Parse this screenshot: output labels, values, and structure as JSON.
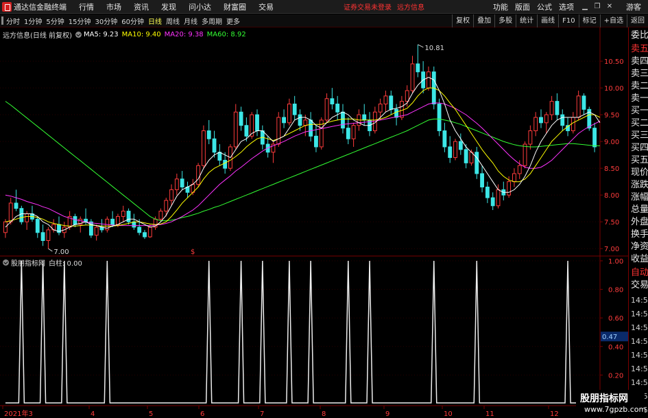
{
  "menubar": {
    "title": "通达信金融终端",
    "items": [
      "行情",
      "市场",
      "资讯",
      "发现",
      "问小达",
      "财富圈",
      "交易"
    ],
    "status_login": "证券交易未登录",
    "status_stock": "远方信息",
    "right_items": [
      "功能",
      "版面",
      "公式",
      "选项"
    ],
    "guest": "游客"
  },
  "toolbar": {
    "periods": [
      "分时",
      "1分钟",
      "5分钟",
      "15分钟",
      "30分钟",
      "60分钟",
      "日线",
      "周线",
      "月线",
      "多周期",
      "更多"
    ],
    "active_period": "日线",
    "right_buttons": [
      "复权",
      "叠加",
      "多股",
      "统计",
      "画线",
      "F10",
      "标记",
      "+自选",
      "返回"
    ]
  },
  "legend": {
    "title": "远方信息(日线 前复权)",
    "ma5": "MA5: 9.23",
    "ma10": "MA10: 9.40",
    "ma20": "MA20: 9.38",
    "ma60": "MA60: 8.92"
  },
  "sub_legend": {
    "title": "股朋指标网",
    "value": "白柱: 0.00"
  },
  "side_panel": {
    "labels": [
      "委比",
      "卖五",
      "卖四",
      "卖三",
      "卖二",
      "卖一",
      "买一",
      "买二",
      "买三",
      "买四",
      "买五",
      "现价",
      "涨跌",
      "涨幅",
      "总量",
      "外盘",
      "换手",
      "净资",
      "收益"
    ],
    "auto_trade": [
      "自动",
      "交易"
    ],
    "times": [
      "14:5",
      "14:5",
      "14:5",
      "14:5",
      "14:5",
      "14:5",
      "14:5",
      "14:5",
      "14:5"
    ]
  },
  "watermark": {
    "name": "股朋指标网",
    "url": "www.7gpzb.com"
  },
  "colors": {
    "up": "#ff3c3c",
    "down": "#3ce6e6",
    "ma5": "#ffffff",
    "ma10": "#ffff00",
    "ma20": "#ff33ff",
    "ma60": "#33ff33",
    "grid": "#7a0000"
  },
  "chart_data": [
    {
      "type": "candlestick",
      "y_axis_labels": [
        "10.50",
        "10.00",
        "9.50",
        "9.00",
        "8.50",
        "8.00",
        "7.50",
        "7.00"
      ],
      "ylim": [
        6.9,
        10.95
      ],
      "annotations": {
        "max": "10.81",
        "min": "7.00"
      },
      "x_axis_labels": [
        "2021年3",
        "4",
        "5",
        "6",
        "7",
        "8",
        "9",
        "10",
        "11",
        "12"
      ],
      "ohlc": [
        [
          7.3,
          7.55,
          7.2,
          7.5
        ],
        [
          7.5,
          7.95,
          7.45,
          7.85
        ],
        [
          7.85,
          8.1,
          7.7,
          7.75
        ],
        [
          7.75,
          7.8,
          7.45,
          7.5
        ],
        [
          7.5,
          7.7,
          7.35,
          7.65
        ],
        [
          7.65,
          7.8,
          7.5,
          7.55
        ],
        [
          7.55,
          7.6,
          7.2,
          7.3
        ],
        [
          7.3,
          7.45,
          7.05,
          7.15
        ],
        [
          7.15,
          7.4,
          7.0,
          7.35
        ],
        [
          7.35,
          7.55,
          7.3,
          7.45
        ],
        [
          7.45,
          7.6,
          7.25,
          7.3
        ],
        [
          7.3,
          7.5,
          7.2,
          7.4
        ],
        [
          7.4,
          7.7,
          7.35,
          7.6
        ],
        [
          7.6,
          7.65,
          7.4,
          7.45
        ],
        [
          7.45,
          7.6,
          7.3,
          7.55
        ],
        [
          7.55,
          7.75,
          7.45,
          7.5
        ],
        [
          7.5,
          7.55,
          7.2,
          7.25
        ],
        [
          7.25,
          7.45,
          7.15,
          7.4
        ],
        [
          7.4,
          7.55,
          7.3,
          7.35
        ],
        [
          7.35,
          7.6,
          7.3,
          7.55
        ],
        [
          7.55,
          7.7,
          7.4,
          7.45
        ],
        [
          7.45,
          7.65,
          7.4,
          7.6
        ],
        [
          7.6,
          7.8,
          7.5,
          7.7
        ],
        [
          7.7,
          7.75,
          7.45,
          7.5
        ],
        [
          7.5,
          7.65,
          7.35,
          7.4
        ],
        [
          7.4,
          7.55,
          7.25,
          7.3
        ],
        [
          7.3,
          7.35,
          7.18,
          7.22
        ],
        [
          7.22,
          7.45,
          7.2,
          7.4
        ],
        [
          7.4,
          7.6,
          7.35,
          7.55
        ],
        [
          7.55,
          7.75,
          7.5,
          7.7
        ],
        [
          7.7,
          7.95,
          7.6,
          7.9
        ],
        [
          7.9,
          8.2,
          7.8,
          8.1
        ],
        [
          8.1,
          8.4,
          8.0,
          8.3
        ],
        [
          8.3,
          8.45,
          8.1,
          8.15
        ],
        [
          8.15,
          8.25,
          7.95,
          8.05
        ],
        [
          8.05,
          8.3,
          8.0,
          8.2
        ],
        [
          8.2,
          8.6,
          8.15,
          8.55
        ],
        [
          8.55,
          9.3,
          8.5,
          9.2
        ],
        [
          9.2,
          9.4,
          8.95,
          9.05
        ],
        [
          9.05,
          9.2,
          8.7,
          8.8
        ],
        [
          8.8,
          8.95,
          8.55,
          8.65
        ],
        [
          8.65,
          8.8,
          8.4,
          8.5
        ],
        [
          8.5,
          8.95,
          8.45,
          8.9
        ],
        [
          8.9,
          9.7,
          8.85,
          9.55
        ],
        [
          9.55,
          9.65,
          9.2,
          9.3
        ],
        [
          9.3,
          9.45,
          9.0,
          9.1
        ],
        [
          9.1,
          9.55,
          9.05,
          9.5
        ],
        [
          9.5,
          9.6,
          9.1,
          9.2
        ],
        [
          9.2,
          9.3,
          8.85,
          8.95
        ],
        [
          8.95,
          9.1,
          8.7,
          8.8
        ],
        [
          8.8,
          9.0,
          8.6,
          8.95
        ],
        [
          8.95,
          9.55,
          8.9,
          9.45
        ],
        [
          9.45,
          9.6,
          9.25,
          9.35
        ],
        [
          9.35,
          9.8,
          9.3,
          9.7
        ],
        [
          9.7,
          9.85,
          9.4,
          9.5
        ],
        [
          9.5,
          9.6,
          9.2,
          9.3
        ],
        [
          9.3,
          9.5,
          9.1,
          9.4
        ],
        [
          9.4,
          9.55,
          9.0,
          9.1
        ],
        [
          9.1,
          9.3,
          8.8,
          8.9
        ],
        [
          8.9,
          9.45,
          8.85,
          9.4
        ],
        [
          9.4,
          9.9,
          9.35,
          9.8
        ],
        [
          9.8,
          10.0,
          9.6,
          9.7
        ],
        [
          9.7,
          9.85,
          9.4,
          9.55
        ],
        [
          9.55,
          9.7,
          9.15,
          9.25
        ],
        [
          9.25,
          9.45,
          8.95,
          9.05
        ],
        [
          9.05,
          9.35,
          8.9,
          9.3
        ],
        [
          9.3,
          9.6,
          9.2,
          9.5
        ],
        [
          9.5,
          9.7,
          9.3,
          9.4
        ],
        [
          9.4,
          9.55,
          9.1,
          9.2
        ],
        [
          9.2,
          9.65,
          9.15,
          9.55
        ],
        [
          9.55,
          9.8,
          9.4,
          9.7
        ],
        [
          9.7,
          9.95,
          9.55,
          9.85
        ],
        [
          9.85,
          9.95,
          9.5,
          9.6
        ],
        [
          9.6,
          9.7,
          9.3,
          9.45
        ],
        [
          9.45,
          9.85,
          9.4,
          9.75
        ],
        [
          9.75,
          10.05,
          9.65,
          9.95
        ],
        [
          9.95,
          10.6,
          9.9,
          10.45
        ],
        [
          10.45,
          10.81,
          10.2,
          10.3
        ],
        [
          10.3,
          10.5,
          9.9,
          10.0
        ],
        [
          10.0,
          10.4,
          9.95,
          10.3
        ],
        [
          10.3,
          10.4,
          9.6,
          9.7
        ],
        [
          9.7,
          9.8,
          9.1,
          9.2
        ],
        [
          9.2,
          9.35,
          8.8,
          8.9
        ],
        [
          8.9,
          9.1,
          8.6,
          8.7
        ],
        [
          8.7,
          9.05,
          8.65,
          9.0
        ],
        [
          9.0,
          9.15,
          8.75,
          8.85
        ],
        [
          8.85,
          8.95,
          8.5,
          8.6
        ],
        [
          8.6,
          8.85,
          8.55,
          8.8
        ],
        [
          8.8,
          8.9,
          8.3,
          8.4
        ],
        [
          8.4,
          8.55,
          8.05,
          8.15
        ],
        [
          8.15,
          8.25,
          7.85,
          7.95
        ],
        [
          7.95,
          8.05,
          7.72,
          7.8
        ],
        [
          7.8,
          8.2,
          7.75,
          8.1
        ],
        [
          8.1,
          8.25,
          7.9,
          8.0
        ],
        [
          8.0,
          8.35,
          7.95,
          8.25
        ],
        [
          8.25,
          8.5,
          8.15,
          8.4
        ],
        [
          8.4,
          8.65,
          8.3,
          8.55
        ],
        [
          8.55,
          9.0,
          8.5,
          8.95
        ],
        [
          8.95,
          9.3,
          8.85,
          9.2
        ],
        [
          9.2,
          9.55,
          9.1,
          9.45
        ],
        [
          9.45,
          9.6,
          9.25,
          9.35
        ],
        [
          9.35,
          9.55,
          9.15,
          9.5
        ],
        [
          9.5,
          9.85,
          9.4,
          9.75
        ],
        [
          9.75,
          9.9,
          9.4,
          9.5
        ],
        [
          9.5,
          9.6,
          9.2,
          9.3
        ],
        [
          9.3,
          9.45,
          9.1,
          9.2
        ],
        [
          9.2,
          9.55,
          9.15,
          9.45
        ],
        [
          9.45,
          9.95,
          9.4,
          9.85
        ],
        [
          9.85,
          9.9,
          9.5,
          9.6
        ],
        [
          9.6,
          9.65,
          9.2,
          9.25
        ],
        [
          9.25,
          9.35,
          8.8,
          8.9
        ]
      ],
      "ma5": [
        7.4,
        7.5,
        7.6,
        7.65,
        7.65,
        7.65,
        7.6,
        7.5,
        7.45,
        7.35,
        7.32,
        7.35,
        7.4,
        7.45,
        7.47,
        7.5,
        7.45,
        7.43,
        7.4,
        7.38,
        7.42,
        7.45,
        7.5,
        7.55,
        7.55,
        7.5,
        7.45,
        7.4,
        7.42,
        7.5,
        7.62,
        7.8,
        7.98,
        8.1,
        8.15,
        8.2,
        8.3,
        8.5,
        8.65,
        8.75,
        8.8,
        8.75,
        8.7,
        8.85,
        9.0,
        9.05,
        9.15,
        9.2,
        9.2,
        9.1,
        9.0,
        9.05,
        9.1,
        9.25,
        9.4,
        9.45,
        9.45,
        9.4,
        9.3,
        9.25,
        9.35,
        9.45,
        9.5,
        9.55,
        9.5,
        9.4,
        9.35,
        9.3,
        9.3,
        9.35,
        9.45,
        9.55,
        9.6,
        9.62,
        9.65,
        9.72,
        9.9,
        10.05,
        10.15,
        10.2,
        10.15,
        9.95,
        9.7,
        9.4,
        9.2,
        9.05,
        8.9,
        8.8,
        8.7,
        8.55,
        8.4,
        8.25,
        8.1,
        8.05,
        8.05,
        8.1,
        8.2,
        8.35,
        8.55,
        8.8,
        9.0,
        9.15,
        9.3,
        9.4,
        9.45,
        9.45,
        9.45,
        9.45,
        9.5,
        9.55,
        9.5,
        9.35
      ],
      "ma10": [
        7.5,
        7.52,
        7.55,
        7.58,
        7.6,
        7.6,
        7.58,
        7.55,
        7.5,
        7.47,
        7.45,
        7.43,
        7.42,
        7.42,
        7.43,
        7.44,
        7.44,
        7.43,
        7.42,
        7.42,
        7.42,
        7.43,
        7.45,
        7.47,
        7.5,
        7.5,
        7.48,
        7.46,
        7.45,
        7.46,
        7.5,
        7.6,
        7.72,
        7.85,
        7.95,
        8.05,
        8.15,
        8.3,
        8.42,
        8.5,
        8.55,
        8.6,
        8.65,
        8.72,
        8.8,
        8.9,
        8.98,
        9.05,
        9.08,
        9.05,
        9.02,
        9.05,
        9.1,
        9.15,
        9.2,
        9.25,
        9.3,
        9.32,
        9.32,
        9.32,
        9.35,
        9.38,
        9.4,
        9.42,
        9.42,
        9.42,
        9.4,
        9.4,
        9.4,
        9.4,
        9.42,
        9.45,
        9.5,
        9.55,
        9.58,
        9.62,
        9.72,
        9.85,
        9.95,
        10.0,
        10.0,
        9.95,
        9.85,
        9.72,
        9.6,
        9.45,
        9.3,
        9.15,
        9.0,
        8.85,
        8.72,
        8.6,
        8.45,
        8.35,
        8.28,
        8.25,
        8.25,
        8.3,
        8.4,
        8.55,
        8.7,
        8.85,
        9.0,
        9.1,
        9.2,
        9.28,
        9.35,
        9.4,
        9.45,
        9.5,
        9.5,
        9.45
      ],
      "ma20": [
        8.0,
        7.98,
        7.95,
        7.92,
        7.88,
        7.85,
        7.82,
        7.78,
        7.75,
        7.7,
        7.65,
        7.6,
        7.57,
        7.54,
        7.52,
        7.5,
        7.48,
        7.47,
        7.46,
        7.45,
        7.44,
        7.43,
        7.43,
        7.43,
        7.43,
        7.43,
        7.43,
        7.43,
        7.44,
        7.45,
        7.47,
        7.5,
        7.55,
        7.6,
        7.66,
        7.72,
        7.8,
        7.9,
        8.0,
        8.1,
        8.2,
        8.28,
        8.36,
        8.45,
        8.52,
        8.6,
        8.68,
        8.75,
        8.82,
        8.88,
        8.92,
        8.96,
        9.0,
        9.05,
        9.1,
        9.14,
        9.18,
        9.2,
        9.22,
        9.24,
        9.26,
        9.28,
        9.3,
        9.32,
        9.33,
        9.34,
        9.35,
        9.36,
        9.37,
        9.38,
        9.4,
        9.42,
        9.44,
        9.46,
        9.48,
        9.5,
        9.55,
        9.6,
        9.65,
        9.7,
        9.72,
        9.72,
        9.7,
        9.66,
        9.62,
        9.56,
        9.5,
        9.42,
        9.34,
        9.25,
        9.15,
        9.05,
        8.95,
        8.85,
        8.75,
        8.66,
        8.58,
        8.52,
        8.5,
        8.5,
        8.52,
        8.58,
        8.65,
        8.75,
        8.85,
        8.95,
        9.05,
        9.15,
        9.22,
        9.28,
        9.33,
        9.38
      ],
      "ma60": [
        9.75,
        9.68,
        9.6,
        9.52,
        9.44,
        9.36,
        9.28,
        9.2,
        9.12,
        9.04,
        8.96,
        8.88,
        8.8,
        8.72,
        8.64,
        8.56,
        8.48,
        8.4,
        8.32,
        8.24,
        8.16,
        8.08,
        8.0,
        7.92,
        7.84,
        7.76,
        7.68,
        7.6,
        7.55,
        7.52,
        7.52,
        7.53,
        7.55,
        7.58,
        7.6,
        7.63,
        7.66,
        7.7,
        7.73,
        7.77,
        7.8,
        7.84,
        7.88,
        7.92,
        7.96,
        8.0,
        8.04,
        8.08,
        8.12,
        8.16,
        8.2,
        8.24,
        8.28,
        8.32,
        8.36,
        8.4,
        8.44,
        8.48,
        8.52,
        8.56,
        8.6,
        8.64,
        8.68,
        8.72,
        8.76,
        8.8,
        8.84,
        8.88,
        8.92,
        8.96,
        9.0,
        9.04,
        9.08,
        9.12,
        9.16,
        9.2,
        9.25,
        9.3,
        9.35,
        9.4,
        9.42,
        9.42,
        9.4,
        9.38,
        9.35,
        9.32,
        9.28,
        9.24,
        9.2,
        9.16,
        9.12,
        9.08,
        9.04,
        9.0,
        8.97,
        8.94,
        8.92,
        8.91,
        8.9,
        8.9,
        8.91,
        8.92,
        8.93,
        8.94,
        8.95,
        8.96,
        8.96,
        8.95,
        8.94,
        8.93,
        8.92,
        8.92
      ]
    },
    {
      "type": "line",
      "series_name": "白柱",
      "y_axis_labels": [
        "1.00",
        "0.80",
        "0.60",
        "0.40",
        "0.20"
      ],
      "ylim": [
        0,
        1.0
      ],
      "current_value_label": "0.47",
      "spike_index": [
        3,
        7,
        11,
        19,
        38,
        44,
        48,
        53,
        57,
        64,
        68,
        80,
        88,
        105
      ]
    }
  ]
}
